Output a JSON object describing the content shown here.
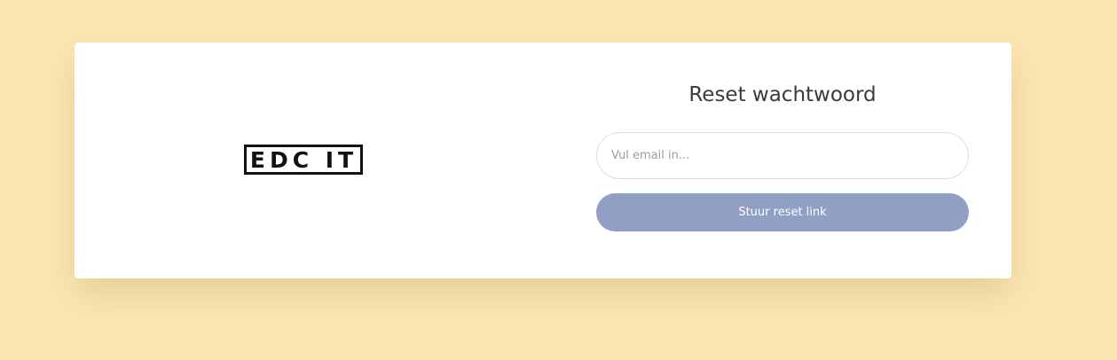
{
  "brand": {
    "logo_text": "EDC IT"
  },
  "reset_form": {
    "title": "Reset wachtwoord",
    "email_placeholder": "Vul email in...",
    "email_value": "",
    "submit_label": "Stuur reset link"
  },
  "colors": {
    "page_background": "#fbe6b3",
    "card_background": "#ffffff",
    "button_background": "#909fc3",
    "button_text": "#ffffff",
    "title_text": "#3b3b3b",
    "logo": "#111111"
  }
}
